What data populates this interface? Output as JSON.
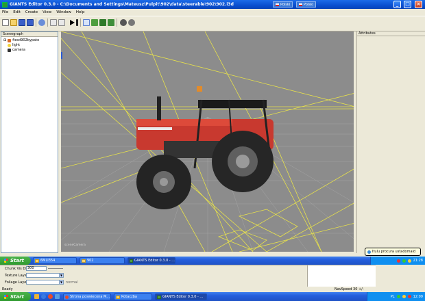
{
  "window": {
    "title": "GIANTS Editor 0.3.0 - C:\\Documents and Settings\\Mateusz\\Pulpit\\902\\data\\steerable\\902\\902.i3d",
    "language_label": "Polski",
    "language_label2": "Polski"
  },
  "menu": [
    "File",
    "Edit",
    "Create",
    "View",
    "Window",
    "Help"
  ],
  "scenegraph": {
    "title": "Scenegraph",
    "items": [
      "fiesd902bypato",
      "light",
      "camera"
    ]
  },
  "attributes": {
    "title": "Attributes"
  },
  "viewport": {
    "camera_label": "sceneCamera"
  },
  "taskbar1": {
    "start_label": "Start",
    "buttons": [
      "6MLI354",
      "902",
      "GIANTS Editor 0.3.0 - ..."
    ],
    "balloon_text": "Itulu procura ustadomaid",
    "clock": "21:28"
  },
  "properties": {
    "chunk_label": "Chunk Vis Dist",
    "chunk_value": "300",
    "texture_label": "Texture Layer",
    "foliage_label": "Foliage Layer",
    "normal_label": "normal"
  },
  "status": {
    "left": "Ready",
    "nav_speed": "NavSpeed 30 +/-"
  },
  "taskbar2": {
    "start_label": "Start",
    "buttons": [
      "Strona poswiecona M...",
      "Rotaczba",
      "GIANTS Editor 0.3.0 - ..."
    ],
    "lang": "PL",
    "clock": "12:09"
  },
  "colors": {
    "tractor_red": "#c8392f",
    "gizmo_yellow": "#e8e24a",
    "viewport_gray": "#8c8c8c"
  }
}
